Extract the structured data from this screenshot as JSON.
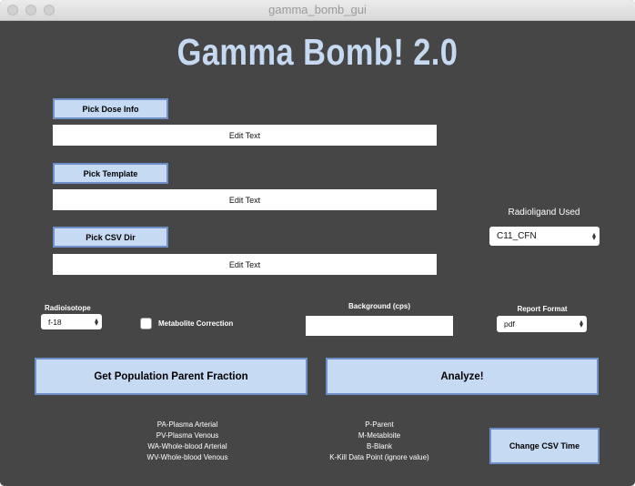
{
  "window": {
    "title": "gamma_bomb_gui"
  },
  "app_title": "Gamma Bomb! 2.0",
  "dose_info": {
    "button": "Pick Dose Info",
    "field": "Edit Text"
  },
  "template": {
    "button": "Pick Template",
    "field": "Edit Text"
  },
  "csv_dir": {
    "button": "Pick CSV Dir",
    "field": "Edit Text"
  },
  "radioligand": {
    "label": "Radioligand Used",
    "selected": "C11_CFN"
  },
  "radioisotope": {
    "label": "Radioisotope",
    "selected": "f-18"
  },
  "metabolite": {
    "label": "Metabolite Correction",
    "checked": false
  },
  "background": {
    "label": "Background (cps)",
    "value": ""
  },
  "report_format": {
    "label": "Report Format",
    "selected": "pdf"
  },
  "actions": {
    "population_parent_fraction": "Get Population Parent Fraction",
    "analyze": "Analyze!"
  },
  "legend": {
    "sample_types": [
      "PA-Plasma Arterial",
      "PV-Plasma Venous",
      "WA-Whole-blood Arterial",
      "WV-Whole-blood Venous"
    ],
    "data_codes": [
      "P-Parent",
      "M-Metabloite",
      "B-Blank",
      "K-Kill Data Point (ignore value)"
    ]
  },
  "change_csv_time": "Change CSV Time",
  "colors": {
    "background": "#464646",
    "button_fill": "#c6daf3",
    "button_border": "#6f8fc9",
    "title": "#c5d9f1"
  }
}
